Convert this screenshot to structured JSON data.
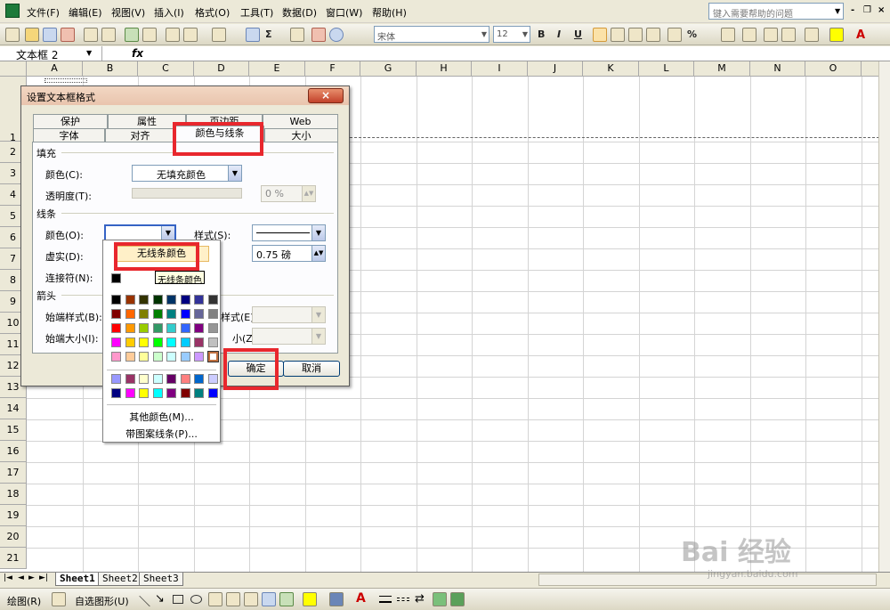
{
  "menubar": {
    "items": [
      "文件(F)",
      "编辑(E)",
      "视图(V)",
      "插入(I)",
      "格式(O)",
      "工具(T)",
      "数据(D)",
      "窗口(W)",
      "帮助(H)"
    ],
    "help_placeholder": "键入需要帮助的问题"
  },
  "toolbar": {
    "font": "宋体",
    "size": "12",
    "bold": "B",
    "italic": "I",
    "underline": "U",
    "sigma": "Σ",
    "percent": "%"
  },
  "formula_bar": {
    "name_box": "文本框 2",
    "fx": "fx"
  },
  "sheet": {
    "columns": [
      "A",
      "B",
      "C",
      "D",
      "E",
      "F",
      "G",
      "H",
      "I",
      "J",
      "K",
      "L",
      "M",
      "N",
      "O"
    ],
    "rows": [
      "1",
      "2",
      "3",
      "4",
      "5",
      "6",
      "7",
      "8",
      "9",
      "10",
      "11",
      "12",
      "13",
      "14",
      "15",
      "16",
      "17",
      "18",
      "19",
      "20",
      "21"
    ],
    "tabs": [
      "Sheet1",
      "Sheet2",
      "Sheet3"
    ]
  },
  "dialog": {
    "title": "设置文本框格式",
    "tabs_back": [
      "保护",
      "属性",
      "页边距",
      "Web"
    ],
    "tabs_front": [
      "字体",
      "对齐",
      "颜色与线条",
      "大小"
    ],
    "active_tab": "颜色与线条",
    "fill": {
      "section": "填充",
      "color_label": "颜色(C):",
      "color_value": "无填充颜色",
      "transparency_label": "透明度(T):",
      "transparency_value": "0 %"
    },
    "line": {
      "section": "线条",
      "color_label": "颜色(O):",
      "style_label": "样式(S):",
      "dash_label": "虚实(D):",
      "weight_value": "0.75 磅",
      "connector_label": "连接符(N):"
    },
    "arrows": {
      "section": "箭头",
      "begin_style_label": "始端样式(B):",
      "end_style_label": "样式(E):",
      "begin_size_label": "始端大小(I):",
      "end_size_label": "小(Z):"
    },
    "ok": "确定",
    "cancel": "取消"
  },
  "color_popup": {
    "no_line": "无线条颜色",
    "tooltip": "无线条颜色",
    "more_colors": "其他颜色(M)...",
    "patterned_lines": "带图案线条(P)...",
    "rows": [
      [
        "#000000",
        "#993300",
        "#333300",
        "#003300",
        "#003366",
        "#000080",
        "#333399",
        "#333333"
      ],
      [
        "#800000",
        "#ff6600",
        "#808000",
        "#008000",
        "#008080",
        "#0000ff",
        "#666699",
        "#808080"
      ],
      [
        "#ff0000",
        "#ff9900",
        "#99cc00",
        "#339966",
        "#33cccc",
        "#3366ff",
        "#800080",
        "#969696"
      ],
      [
        "#ff00ff",
        "#ffcc00",
        "#ffff00",
        "#00ff00",
        "#00ffff",
        "#00ccff",
        "#993366",
        "#c0c0c0"
      ],
      [
        "#ff99cc",
        "#ffcc99",
        "#ffff99",
        "#ccffcc",
        "#ccffff",
        "#99ccff",
        "#cc99ff",
        "#ffffff"
      ]
    ],
    "chart_rows": [
      [
        "#9999ff",
        "#993366",
        "#ffffcc",
        "#ccffff",
        "#660066",
        "#ff8080",
        "#0066cc",
        "#ccccff"
      ],
      [
        "#000080",
        "#ff00ff",
        "#ffff00",
        "#00ffff",
        "#800080",
        "#800000",
        "#008080",
        "#0000ff"
      ]
    ]
  },
  "drawbar": {
    "draw": "绘图(R)",
    "autoshapes": "自选图形(U)"
  },
  "watermark": {
    "logo": "Bai 经验",
    "url": "jingyan.baidu.com"
  }
}
